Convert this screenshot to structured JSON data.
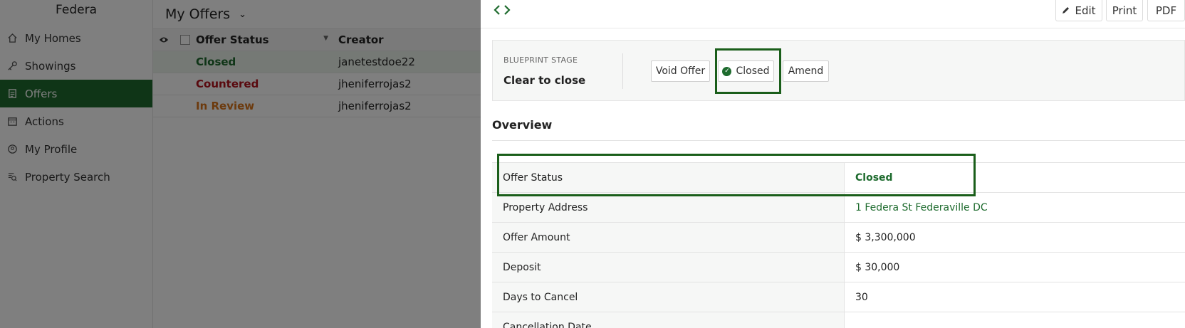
{
  "sidebar": {
    "brand": "Federa",
    "items": [
      {
        "label": "My Homes",
        "icon": "home-icon"
      },
      {
        "label": "Showings",
        "icon": "key-icon"
      },
      {
        "label": "Offers",
        "icon": "document-icon"
      },
      {
        "label": "Actions",
        "icon": "calendar-icon"
      },
      {
        "label": "My Profile",
        "icon": "user-circle-icon"
      },
      {
        "label": "Property Search",
        "icon": "search-list-icon"
      }
    ],
    "active_item": "Offers"
  },
  "list": {
    "title": "My Offers",
    "columns": [
      "Offer Status",
      "Creator"
    ],
    "rows": [
      {
        "status": "Closed",
        "creator": "janetestdoe22"
      },
      {
        "status": "Countered",
        "creator": "jheniferrojas2"
      },
      {
        "status": "In Review",
        "creator": "jheniferrojas2"
      }
    ]
  },
  "panel": {
    "top_buttons": {
      "edit": "Edit",
      "print": "Print",
      "pdf": "PDF"
    },
    "blueprint": {
      "label": "BLUEPRINT STAGE",
      "stage": "Clear to close",
      "buttons": {
        "void": "Void Offer",
        "closed": "Closed",
        "amend": "Amend"
      }
    },
    "overview_title": "Overview",
    "details": [
      {
        "label": "Offer Status",
        "value": "Closed"
      },
      {
        "label": "Property Address",
        "value": "1 Federa St Federaville DC"
      },
      {
        "label": "Offer Amount",
        "value": "$ 3,300,000"
      },
      {
        "label": "Deposit",
        "value": "$ 30,000"
      },
      {
        "label": "Days to Cancel",
        "value": "30"
      },
      {
        "label": "Cancellation Date",
        "value": ""
      }
    ]
  },
  "colors": {
    "brand_green": "#1e6b2e",
    "status_closed": "#1e6b2e",
    "status_countered": "#b3121c",
    "status_in_review": "#d9741b",
    "highlight_box": "#1a5e1a"
  }
}
